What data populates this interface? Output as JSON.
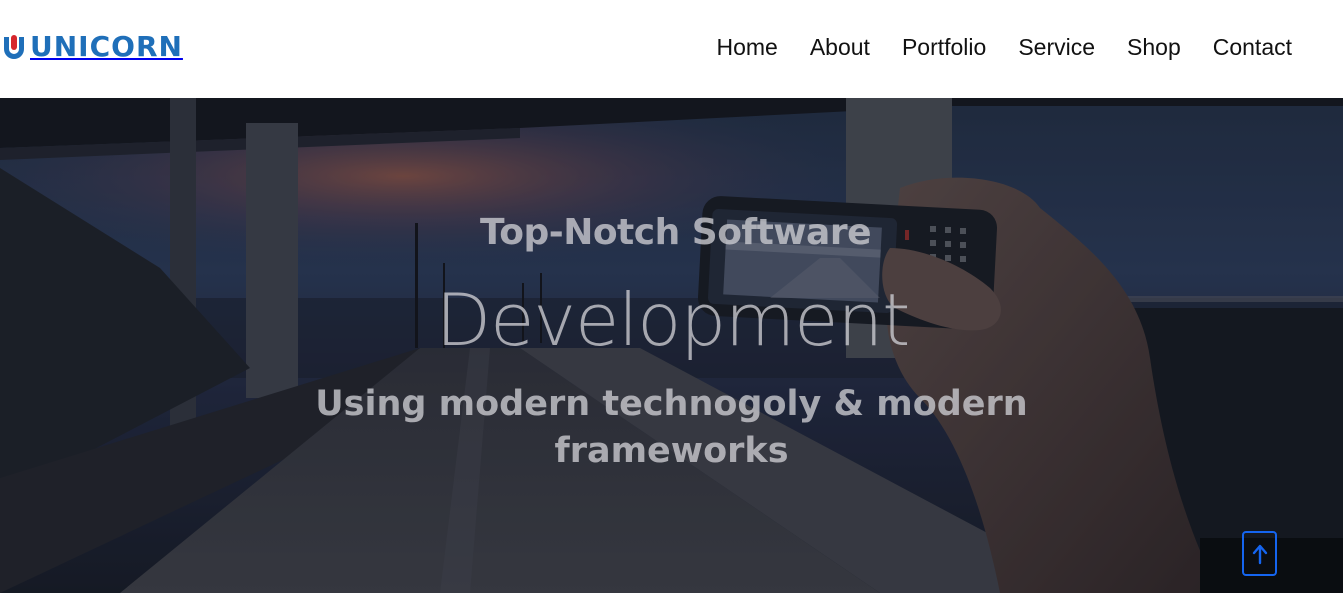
{
  "header": {
    "logo_text": "UNICORN",
    "nav": [
      {
        "label": "Home"
      },
      {
        "label": "About"
      },
      {
        "label": "Portfolio"
      },
      {
        "label": "Service"
      },
      {
        "label": "Shop"
      },
      {
        "label": "Contact"
      }
    ]
  },
  "hero": {
    "eyebrow": "Top-Notch Software",
    "title": "Development",
    "subtitle_line1": "Using modern technogoly & modern",
    "subtitle_line2": "frameworks",
    "background_image": "twilight-road-hand-holding-phone-photo"
  },
  "back_to_top": {
    "icon": "arrow-up-icon"
  },
  "colors": {
    "brand_blue": "#1f6fb9",
    "logo_red": "#d6262c",
    "back_to_top_border": "#1565f0",
    "nav_text": "#111111"
  }
}
